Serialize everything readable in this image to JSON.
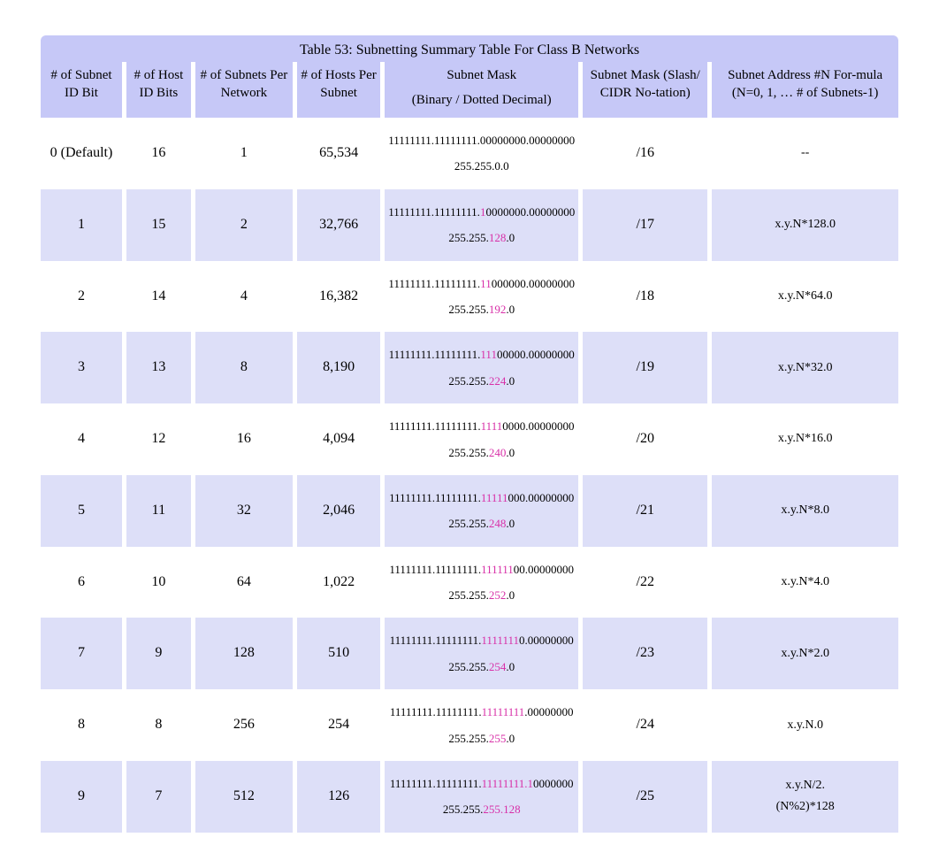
{
  "title": "Table 53: Subnetting Summary Table For Class B Networks",
  "headers": {
    "subnet_bits": "# of Subnet ID Bit",
    "host_bits": "# of Host ID Bits",
    "subnets": "# of Subnets Per Network",
    "hosts": "# of Hosts Per Subnet",
    "mask_top": "Subnet Mask",
    "mask_sub": "(Binary / Dotted Decimal)",
    "cidr_top": "Subnet Mask (Slash/ CIDR No-tation)",
    "formula": "Subnet Address #N For-mula (N=0, 1, … # of Subnets-1)"
  },
  "rows": [
    {
      "subnet_bits": "0 (Default)",
      "host_bits": "16",
      "subnets": "1",
      "hosts": "65,534",
      "bin_pre": "11111111.11111111.",
      "bin_hl": "",
      "bin_post": "00000000.00000000",
      "dec_pre": "255.255.",
      "dec_hl": "",
      "dec_post": "0.0",
      "cidr": "/16",
      "formula": "--",
      "formula2": ""
    },
    {
      "subnet_bits": "1",
      "host_bits": "15",
      "subnets": "2",
      "hosts": "32,766",
      "bin_pre": "11111111.11111111.",
      "bin_hl": "1",
      "bin_post": "0000000.00000000",
      "dec_pre": "255.255.",
      "dec_hl": "128",
      "dec_post": ".0",
      "cidr": "/17",
      "formula": "x.y.N*128.0",
      "formula2": ""
    },
    {
      "subnet_bits": "2",
      "host_bits": "14",
      "subnets": "4",
      "hosts": "16,382",
      "bin_pre": "11111111.11111111.",
      "bin_hl": "11",
      "bin_post": "000000.00000000",
      "dec_pre": "255.255.",
      "dec_hl": "192",
      "dec_post": ".0",
      "cidr": "/18",
      "formula": "x.y.N*64.0",
      "formula2": ""
    },
    {
      "subnet_bits": "3",
      "host_bits": "13",
      "subnets": "8",
      "hosts": "8,190",
      "bin_pre": "11111111.11111111.",
      "bin_hl": "111",
      "bin_post": "00000.00000000",
      "dec_pre": "255.255.",
      "dec_hl": "224",
      "dec_post": ".0",
      "cidr": "/19",
      "formula": "x.y.N*32.0",
      "formula2": ""
    },
    {
      "subnet_bits": "4",
      "host_bits": "12",
      "subnets": "16",
      "hosts": "4,094",
      "bin_pre": "11111111.11111111.",
      "bin_hl": "1111",
      "bin_post": "0000.00000000",
      "dec_pre": "255.255.",
      "dec_hl": "240",
      "dec_post": ".0",
      "cidr": "/20",
      "formula": "x.y.N*16.0",
      "formula2": ""
    },
    {
      "subnet_bits": "5",
      "host_bits": "11",
      "subnets": "32",
      "hosts": "2,046",
      "bin_pre": "11111111.11111111.",
      "bin_hl": "11111",
      "bin_post": "000.00000000",
      "dec_pre": "255.255.",
      "dec_hl": "248",
      "dec_post": ".0",
      "cidr": "/21",
      "formula": "x.y.N*8.0",
      "formula2": ""
    },
    {
      "subnet_bits": "6",
      "host_bits": "10",
      "subnets": "64",
      "hosts": "1,022",
      "bin_pre": "11111111.11111111.",
      "bin_hl": "111111",
      "bin_post": "00.00000000",
      "dec_pre": "255.255.",
      "dec_hl": "252",
      "dec_post": ".0",
      "cidr": "/22",
      "formula": "x.y.N*4.0",
      "formula2": ""
    },
    {
      "subnet_bits": "7",
      "host_bits": "9",
      "subnets": "128",
      "hosts": "510",
      "bin_pre": "11111111.11111111.",
      "bin_hl": "1111111",
      "bin_post": "0.00000000",
      "dec_pre": "255.255.",
      "dec_hl": "254",
      "dec_post": ".0",
      "cidr": "/23",
      "formula": "x.y.N*2.0",
      "formula2": ""
    },
    {
      "subnet_bits": "8",
      "host_bits": "8",
      "subnets": "256",
      "hosts": "254",
      "bin_pre": "11111111.11111111.",
      "bin_hl": "11111111",
      "bin_post": ".00000000",
      "dec_pre": "255.255.",
      "dec_hl": "255",
      "dec_post": ".0",
      "cidr": "/24",
      "formula": "x.y.N.0",
      "formula2": ""
    },
    {
      "subnet_bits": "9",
      "host_bits": "7",
      "subnets": "512",
      "hosts": "126",
      "bin_pre": "11111111.11111111.",
      "bin_hl": "11111111",
      "bin_post": "0000000",
      "bin_hl2": ".1",
      "dec_pre": "255.255.",
      "dec_hl": "255",
      "dec_post": "",
      "dec_hl2": ".128",
      "cidr": "/25",
      "formula": "x.y.N/2.",
      "formula2": "(N%2)*128"
    }
  ]
}
